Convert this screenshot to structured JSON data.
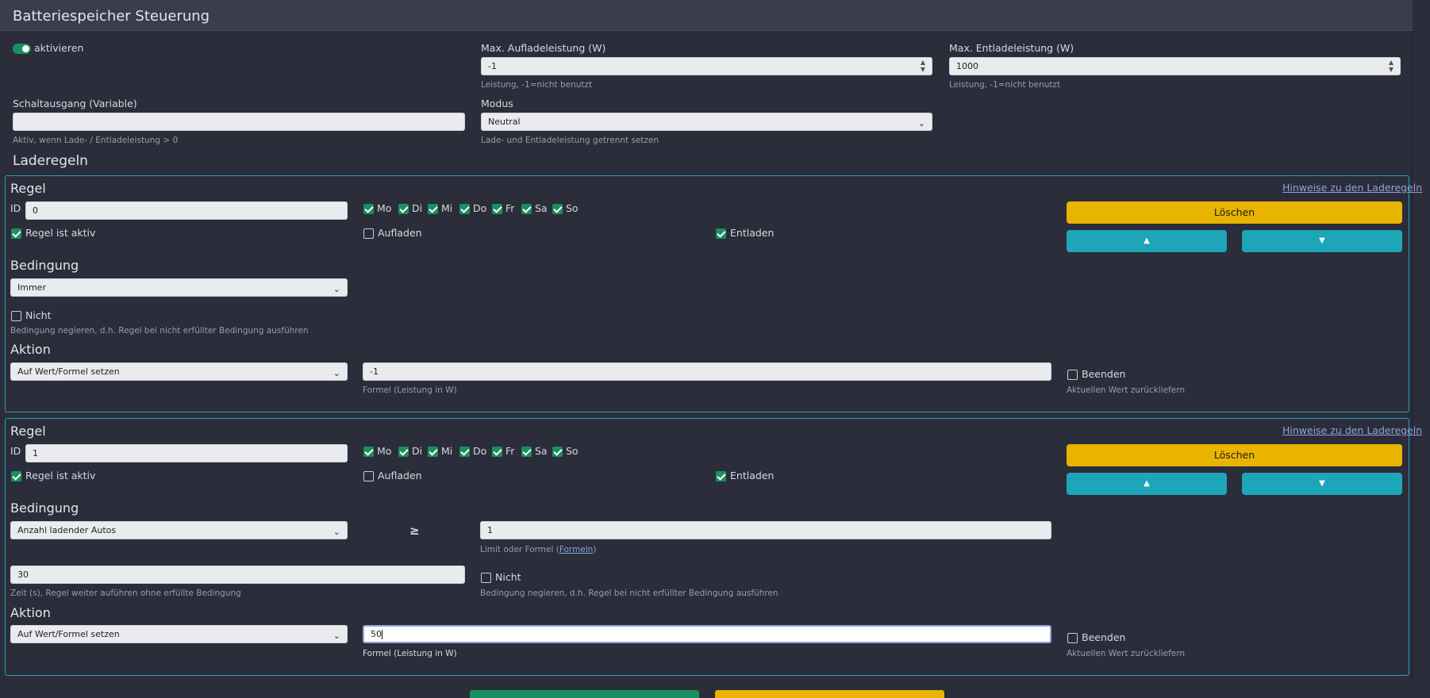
{
  "header": {
    "title": "Batteriespeicher Steuerung"
  },
  "general": {
    "activate_label": "aktivieren",
    "max_charge": {
      "label": "Max. Aufladeleistung (W)",
      "value": "-1",
      "hint": "Leistung, -1=nicht benutzt"
    },
    "max_discharge": {
      "label": "Max. Entladeleistung (W)",
      "value": "1000",
      "hint": "Leistung, -1=nicht benutzt"
    },
    "switch_output": {
      "label": "Schaltausgang (Variable)",
      "value": "",
      "hint": "Aktiv, wenn Lade- / Entladeleistung > 0"
    },
    "mode": {
      "label": "Modus",
      "value": "Neutral",
      "hint": "Lade- und Entladeleistung getrennt setzen"
    }
  },
  "rules_title": "Laderegeln",
  "rules": [
    {
      "title": "Regel",
      "hint_link": "Hinweise zu den Laderegeln",
      "id_label": "ID",
      "id_value": "0",
      "days": [
        "Mo",
        "Di",
        "Mi",
        "Do",
        "Fr",
        "Sa",
        "So"
      ],
      "active_label": "Regel ist aktiv",
      "charge_label": "Aufladen",
      "discharge_label": "Entladen",
      "delete_label": "Löschen",
      "up_icon": "arrow-up-icon",
      "down_icon": "arrow-down-icon",
      "condition_title": "Bedingung",
      "condition_value": "Immer",
      "not_label": "Nicht",
      "not_hint": "Bedingung negieren, d.h. Regel bei nicht erfüllter Bedingung ausführen",
      "action_title": "Aktion",
      "action_value": "Auf Wert/Formel setzen",
      "formula_value": "-1",
      "formula_hint": "Formel (Leistung in W)",
      "end_label": "Beenden",
      "end_hint": "Aktuellen Wert zurückliefern"
    },
    {
      "title": "Regel",
      "hint_link": "Hinweise zu den Laderegeln",
      "id_label": "ID",
      "id_value": "1",
      "days": [
        "Mo",
        "Di",
        "Mi",
        "Do",
        "Fr",
        "Sa",
        "So"
      ],
      "active_label": "Regel ist aktiv",
      "charge_label": "Aufladen",
      "discharge_label": "Entladen",
      "delete_label": "Löschen",
      "up_icon": "arrow-up-icon",
      "down_icon": "arrow-down-icon",
      "condition_title": "Bedingung",
      "condition_value": "Anzahl ladender Autos",
      "operator": "≥",
      "limit_value": "1",
      "limit_hint_prefix": "Limit oder Formel (",
      "limit_hint_link": "Formeln",
      "limit_hint_suffix": ")",
      "time_value": "30",
      "time_hint": "Zeit (s), Regel weiter auführen ohne erfüllte Bedingung",
      "not_label": "Nicht",
      "not_hint": "Bedingung negieren, d.h. Regel bei nicht erfüllter Bedingung ausführen",
      "action_title": "Aktion",
      "action_value": "Auf Wert/Formel setzen",
      "formula_value": "50",
      "formula_hint": "Formel (Leistung in W)",
      "end_label": "Beenden",
      "end_hint": "Aktuellen Wert zurückliefern"
    }
  ],
  "colors": {
    "accent_green": "#1a8f5f",
    "accent_teal": "#1ea5b8",
    "accent_yellow": "#e8b400",
    "background": "#2b2d3a"
  }
}
